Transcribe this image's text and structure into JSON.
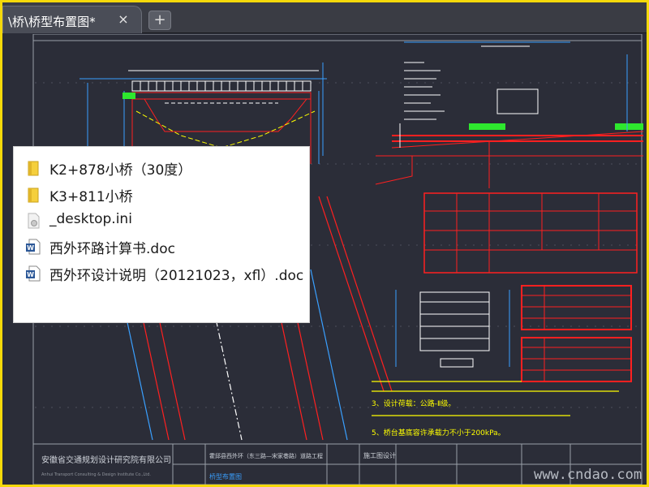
{
  "tab": {
    "title": "\\桥\\桥型布置图*",
    "close_glyph": "×",
    "new_tab_glyph": "+"
  },
  "files": [
    {
      "name": "K2+878小桥（30度）",
      "icon": "folder-icon"
    },
    {
      "name": "K3+811小桥",
      "icon": "folder-icon"
    },
    {
      "name": "_desktop.ini",
      "icon": "ini-file-icon"
    },
    {
      "name": "西外环路计算书.doc",
      "icon": "word-doc-icon"
    },
    {
      "name": "西外环设计说明（20121023，xfl）.doc",
      "icon": "word-doc-icon"
    }
  ],
  "drawing": {
    "notes": [
      "3、设计荷载：公路-Ⅱ级。",
      "5、桥台基底容许承载力不小于200kPa。"
    ],
    "title_block": {
      "institute": "安徽省交通规划设计研究院有限公司",
      "institute_en": "Anhui Transport Consulting & Design Institute Co.,Ltd.",
      "project": "霍邱县西外环（东三路—宋家巷路）道路工程",
      "stage": "施工图设计",
      "drawing_name": "桥型布置图"
    },
    "watermark": "www.cndao.com"
  },
  "colors": {
    "canvas": "#2b2d38",
    "border": "#f5d90a",
    "cad_red": "#ff2020",
    "cad_yellow": "#ffff00",
    "cad_blue": "#3aa0ff",
    "cad_white": "#ffffff",
    "cad_green": "#2ee82e"
  }
}
